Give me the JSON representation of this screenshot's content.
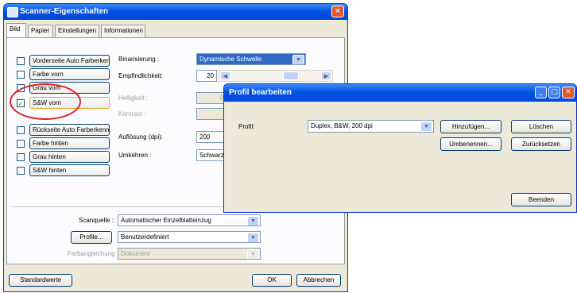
{
  "main_window": {
    "title": "Scanner-Eigenschaften",
    "close_glyph": "✕",
    "tabs": [
      {
        "label": "Bild"
      },
      {
        "label": "Papier"
      },
      {
        "label": "Einstellungen"
      },
      {
        "label": "Informationen"
      }
    ],
    "image_list": [
      {
        "label": "Vorderseite Auto Farberkennu",
        "checked": false
      },
      {
        "label": "Farbe vorn",
        "checked": false
      },
      {
        "label": "Grau vorn",
        "checked": false
      },
      {
        "label": "S&W vorn",
        "checked": true
      },
      {
        "label": "Rückseite Auto Farberkennur",
        "checked": false
      },
      {
        "label": "Farbe hinten",
        "checked": false
      },
      {
        "label": "Grau hinten",
        "checked": false
      },
      {
        "label": "S&W hinten",
        "checked": false
      }
    ],
    "check_glyph": "✓",
    "settings": {
      "binarization_label": "Binarisierung :",
      "binarization_value": "Dynamische Schwelle",
      "sensitivity_label": "Empfindlichkeit:",
      "sensitivity_value": "20",
      "brightness_label": "Helligkeit :",
      "brightness_value": "0",
      "contrast_label": "Kontrast :",
      "resolution_label": "Auflösung (dpi):",
      "resolution_value": "200",
      "invert_label": "Umkehren :",
      "invert_value": "Schwarz a"
    },
    "scan_source_label": "Scanquelle :",
    "scan_source_value": "Automatischer Einzelblatteinzug",
    "profile_button": "Profile...",
    "profile_value": "Benutzerdefiniert",
    "color_matching_label": "Farbangleichung :",
    "color_matching_value": "Dokument",
    "defaults_button": "Standardwerte",
    "ok_button": "OK",
    "cancel_button": "Abbrechen"
  },
  "dialog": {
    "title": "Profil bearbeiten",
    "profile_label": "Profil:",
    "profile_value": "Duplex, B&W, 200 dpi",
    "add_button": "Hinzufügen...",
    "delete_button": "Löschen",
    "rename_button": "Umbenennen...",
    "reset_button": "Zurücksetzen",
    "exit_button": "Beenden",
    "minimize_glyph": "_",
    "maximize_glyph": "□",
    "close_glyph": "✕"
  },
  "colors": {
    "titlebar": "#0054e3",
    "annotation_circle": "#e0202a",
    "selection": "#316ac5"
  }
}
